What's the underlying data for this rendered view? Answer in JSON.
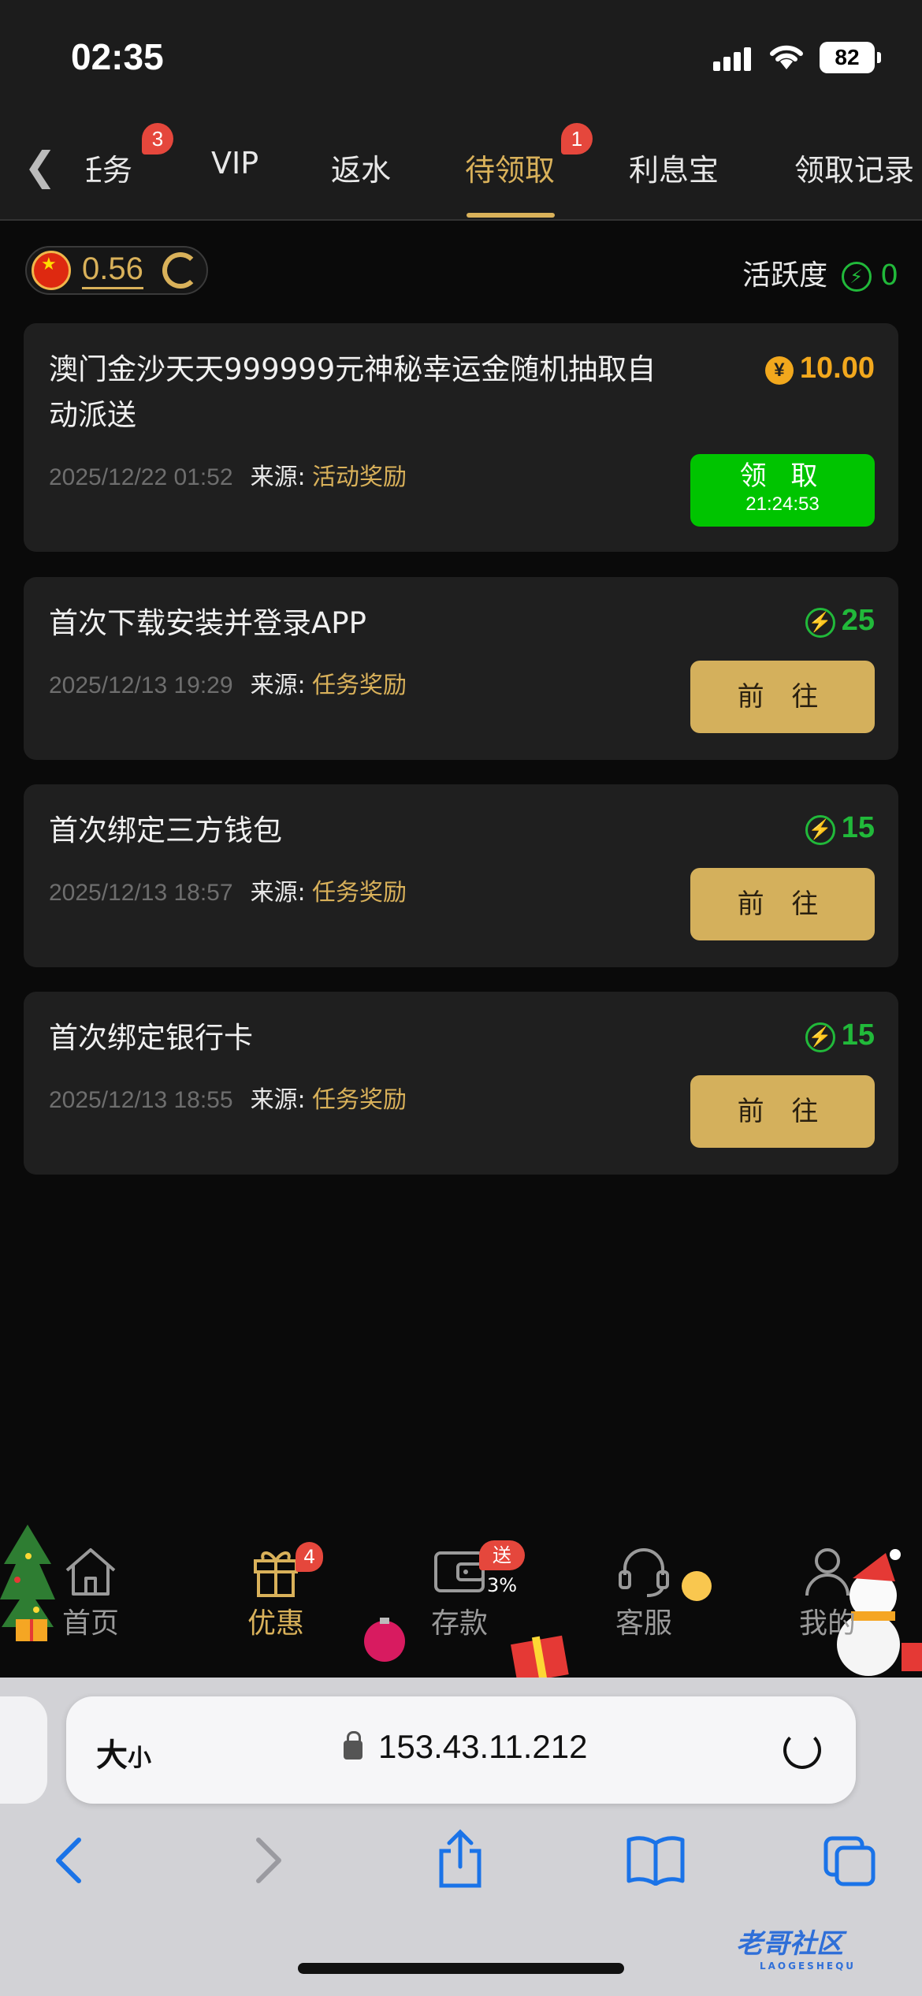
{
  "status_bar": {
    "time": "02:35",
    "battery": "82"
  },
  "tabs": {
    "items": [
      {
        "label": "任务",
        "badge": "3"
      },
      {
        "label": "VIP"
      },
      {
        "label": "返水"
      },
      {
        "label": "待领取",
        "badge": "1",
        "active": true
      },
      {
        "label": "利息宝"
      },
      {
        "label": "领取记录"
      }
    ]
  },
  "summary": {
    "balance": "0.56",
    "activity_label": "活跃度",
    "activity_value": "0"
  },
  "cards": [
    {
      "title": "澳门金沙天天999999元神秘幸运金随机抽取自动派送",
      "title_line1": "澳门金沙天天999999元神秘幸运金随机抽取自",
      "title_line2": "动派送",
      "datetime": "2025/12/22 01:52",
      "source_label": "来源:",
      "source": "活动奖励",
      "reward": "10.00",
      "reward_type": "coin",
      "button_label": "领 取",
      "button_timer": "21:24:53"
    },
    {
      "title": "首次下载安装并登录APP",
      "datetime": "2025/12/13 19:29",
      "source_label": "来源:",
      "source": "任务奖励",
      "reward": "25",
      "reward_type": "activity",
      "button_label": "前 往"
    },
    {
      "title": "首次绑定三方钱包",
      "datetime": "2025/12/13 18:57",
      "source_label": "来源:",
      "source": "任务奖励",
      "reward": "15",
      "reward_type": "activity",
      "button_label": "前 往"
    },
    {
      "title": "首次绑定银行卡",
      "datetime": "2025/12/13 18:55",
      "source_label": "来源:",
      "source": "任务奖励",
      "reward": "15",
      "reward_type": "activity",
      "button_label": "前 往"
    }
  ],
  "bottom_nav": {
    "items": [
      {
        "label": "首页",
        "icon": "home-icon"
      },
      {
        "label": "优惠",
        "icon": "gift-icon",
        "badge": "4",
        "active": true
      },
      {
        "label": "存款",
        "icon": "wallet-icon",
        "badge": "送3%"
      },
      {
        "label": "客服",
        "icon": "headset-icon"
      },
      {
        "label": "我的",
        "icon": "person-icon"
      }
    ]
  },
  "browser": {
    "text_size_label_big": "大",
    "text_size_label_small": "小",
    "url": "153.43.11.212"
  },
  "watermark": {
    "title": "老哥社区",
    "sub": "LAOGESHEQU"
  },
  "colors": {
    "accent_gold": "#d9b15a",
    "green": "#21b93a",
    "claim_green": "#00c400",
    "badge_red": "#e5473c"
  }
}
